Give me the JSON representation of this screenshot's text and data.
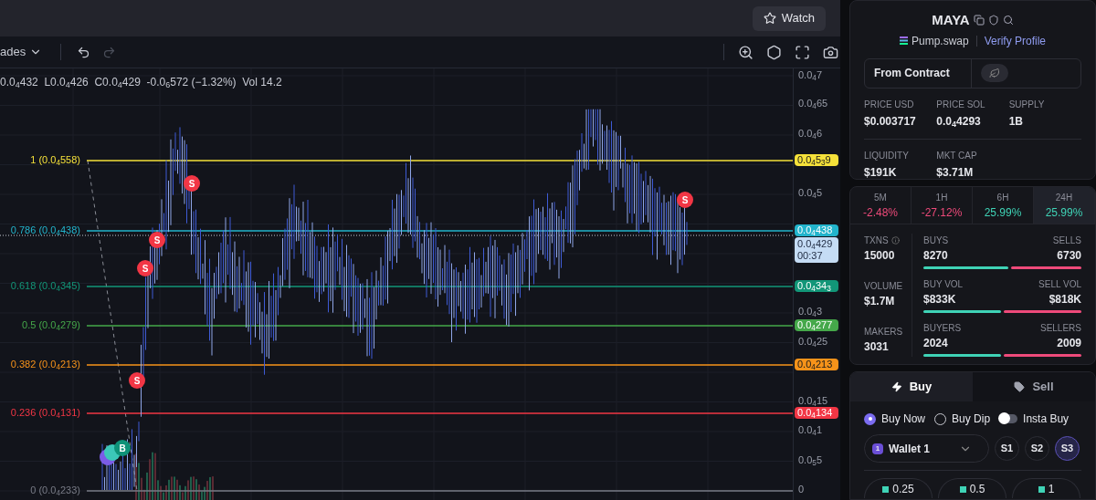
{
  "top_bar": {
    "watch_button": "Watch"
  },
  "toolbar": {
    "interval_menu": "ades",
    "history": [
      {
        "kind": "undo",
        "disabled": false
      },
      {
        "kind": "redo",
        "disabled": true
      }
    ]
  },
  "chart": {
    "ohlc": "0.0$_{4}$432  L0.0$_{4}$426  C0.0$_{4}$429  -0.0$_{6}$572 (−1.32%)  Vol 14.2",
    "price_ticks": [
      "0.0$_{4}$7",
      "0.0$_{4}$65",
      "0.0$_{4}$6",
      "0.0$_{4}$5",
      "0.0$_{4}$3",
      "0.0$_{4}$25",
      "0.0$_{4}$15",
      "0.0$_{4}$1",
      "0.0$_{5}$5",
      "0"
    ],
    "fib_levels": [
      {
        "label": "1 (0.0$_{4}$558)",
        "tag": "0.0$_{4}$5$_{3}$9",
        "color": "#f5e13a"
      },
      {
        "label": "0.786 (0.0$_{4}$438)",
        "tag": "0.0$_{4}$438",
        "color": "#22b4cc"
      },
      {
        "label": "0.618 (0.0$_{4}$345)",
        "tag": "0.0$_{4}$34$_{3}$",
        "color": "#129678"
      },
      {
        "label": "0.5 (0.0$_{4}$279)",
        "tag": "0.0$_{4}$277",
        "color": "#45a84a"
      },
      {
        "label": "0.382 (0.0$_{4}$213)",
        "tag": "0.0$_{4}$213",
        "color": "#f7931a"
      },
      {
        "label": "0.236 (0.0$_{4}$131)",
        "tag": "0.0$_{4}$134",
        "color": "#f23645"
      },
      {
        "label": "0 (0.0$_{4}$233)",
        "color": "#787b86"
      }
    ],
    "current_price": {
      "price": "0.0$_{4}$429",
      "countdown": "00:37"
    },
    "markers": [
      {
        "kind": "sell",
        "label": "S"
      },
      {
        "kind": "sell",
        "label": "S"
      },
      {
        "kind": "sell",
        "label": "S"
      },
      {
        "kind": "sell",
        "label": "S"
      },
      {
        "kind": "sell",
        "label": "S"
      },
      {
        "kind": "buy",
        "label": "B"
      }
    ]
  },
  "token": {
    "name": "MAYA",
    "dex": "Pump.swap",
    "verify_link": "Verify Profile",
    "source_button": "From Contract",
    "stats": [
      {
        "label": "PRICE USD",
        "value": "$0.003717"
      },
      {
        "label": "PRICE SOL",
        "value": "0.0$_{4}$4293"
      },
      {
        "label": "SUPPLY",
        "value": "1B"
      },
      {
        "label": "LIQUIDITY",
        "value": "$191K"
      },
      {
        "label": "MKT CAP",
        "value": "$3.71M"
      }
    ]
  },
  "timeframes": [
    {
      "label": "5M",
      "change": "-2.48%",
      "color": "#ee4a7a",
      "selected": false
    },
    {
      "label": "1H",
      "change": "-27.12%",
      "color": "#ee4a7a",
      "selected": false
    },
    {
      "label": "6H",
      "change": "25.99%",
      "color": "#3fd3b6",
      "selected": false
    },
    {
      "label": "24H",
      "change": "25.99%",
      "color": "#3fd3b6",
      "selected": true
    }
  ],
  "activity": [
    {
      "label": "TXNS",
      "value": "15000",
      "info": true,
      "buy_label": "BUYS",
      "buy_value": "8270",
      "sell_label": "SELLS",
      "sell_value": "6730"
    },
    {
      "label": "VOLUME",
      "value": "$1.7M",
      "info": false,
      "buy_label": "BUY VOL",
      "buy_value": "$833K",
      "sell_label": "SELL VOL",
      "sell_value": "$818K"
    },
    {
      "label": "MAKERS",
      "value": "3031",
      "info": false,
      "buy_label": "BUYERS",
      "buy_value": "2024",
      "sell_label": "SELLERS",
      "sell_value": "2009"
    }
  ],
  "trade": {
    "tabs": [
      {
        "label": "Buy",
        "kind": "buy",
        "selected": true
      },
      {
        "label": "Sell",
        "kind": "sell",
        "selected": false
      }
    ],
    "order_types": [
      {
        "label": "Buy Now",
        "selected": true
      },
      {
        "label": "Buy Dip",
        "selected": false
      }
    ],
    "insta_buy": {
      "label": "Insta Buy",
      "on": false
    },
    "wallet": {
      "badge": "1",
      "label": "Wallet 1"
    },
    "slots": [
      {
        "label": "S1",
        "selected": false
      },
      {
        "label": "S2",
        "selected": false
      },
      {
        "label": "S3",
        "selected": true
      }
    ],
    "amounts": [
      "0.25",
      "0.5",
      "1"
    ]
  }
}
